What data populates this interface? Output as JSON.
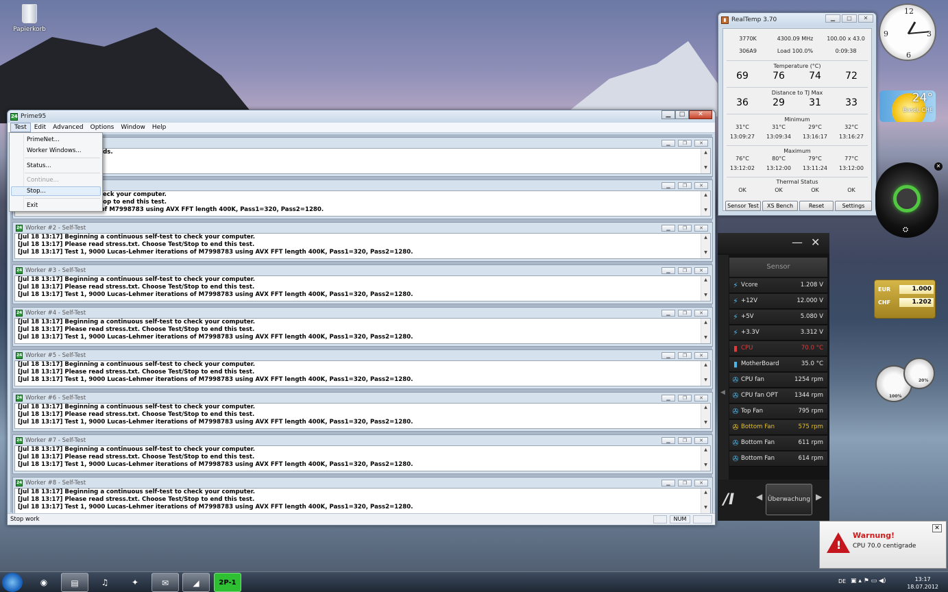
{
  "desktop": {
    "recycle_bin_label": "Papierkorb"
  },
  "prime95": {
    "title": "Prime95",
    "menu": [
      "Test",
      "Edit",
      "Advanced",
      "Options",
      "Window",
      "Help"
    ],
    "test_menu": {
      "items": [
        "PrimeNet...",
        "Worker Windows...",
        "Status...",
        "Continue...",
        "Stop...",
        "Exit"
      ],
      "highlighted": "Stop...",
      "disabled": [
        "Continue..."
      ]
    },
    "main_log": [
      "Stopping all worker threads.",
      "Execution halted.",
      "Starting workers."
    ],
    "worker1_log": [
      "continuous self-test to check your computer.",
      "stress.txt.  Choose Test/Stop to end this test.",
      "Lucas-Lehmer iterations of M7998783 using AVX FFT length 400K, Pass1=320, Pass2=1280."
    ],
    "workers": [
      {
        "title": "Worker #2 - Self-Test",
        "lines": [
          "[Jul 18 13:17] Beginning a continuous self-test to check your computer.",
          "[Jul 18 13:17] Please read stress.txt.  Choose Test/Stop to end this test.",
          "[Jul 18 13:17] Test 1, 9000 Lucas-Lehmer iterations of M7998783 using AVX FFT length 400K, Pass1=320, Pass2=1280."
        ]
      },
      {
        "title": "Worker #3 - Self-Test",
        "lines": [
          "[Jul 18 13:17] Beginning a continuous self-test to check your computer.",
          "[Jul 18 13:17] Please read stress.txt.  Choose Test/Stop to end this test.",
          "[Jul 18 13:17] Test 1, 9000 Lucas-Lehmer iterations of M7998783 using AVX FFT length 400K, Pass1=320, Pass2=1280."
        ]
      },
      {
        "title": "Worker #4 - Self-Test",
        "lines": [
          "[Jul 18 13:17] Beginning a continuous self-test to check your computer.",
          "[Jul 18 13:17] Please read stress.txt.  Choose Test/Stop to end this test.",
          "[Jul 18 13:17] Test 1, 9000 Lucas-Lehmer iterations of M7998783 using AVX FFT length 400K, Pass1=320, Pass2=1280."
        ]
      },
      {
        "title": "Worker #5 - Self-Test",
        "lines": [
          "[Jul 18 13:17] Beginning a continuous self-test to check your computer.",
          "[Jul 18 13:17] Please read stress.txt.  Choose Test/Stop to end this test.",
          "[Jul 18 13:17] Test 1, 9000 Lucas-Lehmer iterations of M7998783 using AVX FFT length 400K, Pass1=320, Pass2=1280."
        ]
      },
      {
        "title": "Worker #6 - Self-Test",
        "lines": [
          "[Jul 18 13:17] Beginning a continuous self-test to check your computer.",
          "[Jul 18 13:17] Please read stress.txt.  Choose Test/Stop to end this test.",
          "[Jul 18 13:17] Test 1, 9000 Lucas-Lehmer iterations of M7998783 using AVX FFT length 400K, Pass1=320, Pass2=1280."
        ]
      },
      {
        "title": "Worker #7 - Self-Test",
        "lines": [
          "[Jul 18 13:17] Beginning a continuous self-test to check your computer.",
          "[Jul 18 13:17] Please read stress.txt.  Choose Test/Stop to end this test.",
          "[Jul 18 13:17] Test 1, 9000 Lucas-Lehmer iterations of M7998783 using AVX FFT length 400K, Pass1=320, Pass2=1280."
        ]
      },
      {
        "title": "Worker #8 - Self-Test",
        "lines": [
          "[Jul 18 13:17] Beginning a continuous self-test to check your computer.",
          "[Jul 18 13:17] Please read stress.txt.  Choose Test/Stop to end this test.",
          "[Jul 18 13:17] Test 1, 9000 Lucas-Lehmer iterations of M7998783 using AVX FFT length 400K, Pass1=320, Pass2=1280."
        ]
      }
    ],
    "status_text": "Stop work",
    "status_num": "NUM"
  },
  "realtemp": {
    "title": "RealTemp 3.70",
    "cpu": "3770K",
    "mhz": "4300.09 MHz",
    "multiplier": "100.00 x 43.0",
    "cpuid": "306A9",
    "load": "Load 100.0%",
    "elapsed": "0:09:38",
    "temperature_label": "Temperature (°C)",
    "temperatures": [
      "69",
      "76",
      "74",
      "72"
    ],
    "distance_label": "Distance to TJ Max",
    "distances": [
      "36",
      "29",
      "31",
      "33"
    ],
    "minimum_label": "Minimum",
    "min_temps": [
      "31°C",
      "31°C",
      "29°C",
      "32°C"
    ],
    "min_times": [
      "13:09:27",
      "13:09:34",
      "13:16:17",
      "13:16:27"
    ],
    "maximum_label": "Maximum",
    "max_temps": [
      "76°C",
      "80°C",
      "79°C",
      "77°C"
    ],
    "max_times": [
      "13:12:02",
      "13:12:00",
      "13:11:24",
      "13:12:00"
    ],
    "thermal_label": "Thermal Status",
    "thermal": [
      "OK",
      "OK",
      "OK",
      "OK"
    ],
    "buttons": [
      "Sensor Test",
      "XS Bench",
      "Reset",
      "Settings"
    ]
  },
  "weather": {
    "temp": "24°",
    "location": "Basel, CHE"
  },
  "sensor_panel": {
    "header": "Sensor",
    "rows": [
      {
        "name": "Vcore",
        "value": "1.208  V",
        "icon": "bolt",
        "color": "#e6e6e6"
      },
      {
        "name": "+12V",
        "value": "12.000  V",
        "icon": "bolt",
        "color": "#e6e6e6"
      },
      {
        "name": "+5V",
        "value": "5.080  V",
        "icon": "bolt",
        "color": "#e6e6e6"
      },
      {
        "name": "+3.3V",
        "value": "3.312  V",
        "icon": "bolt",
        "color": "#e6e6e6"
      },
      {
        "name": "CPU",
        "value": "70.0 °C",
        "icon": "thermo",
        "color": "#e13a3a"
      },
      {
        "name": "MotherBoard",
        "value": "35.0 °C",
        "icon": "thermo",
        "color": "#e6e6e6"
      },
      {
        "name": "CPU fan",
        "value": "1254  rpm",
        "icon": "fan",
        "color": "#e6e6e6"
      },
      {
        "name": "CPU fan OPT",
        "value": "1344  rpm",
        "icon": "fan",
        "color": "#e6e6e6"
      },
      {
        "name": "Top Fan",
        "value": "795  rpm",
        "icon": "fan",
        "color": "#e6e6e6"
      },
      {
        "name": "Bottom Fan",
        "value": "575  rpm",
        "icon": "fan",
        "color": "#e3c030"
      },
      {
        "name": "Bottom Fan",
        "value": "611  rpm",
        "icon": "fan",
        "color": "#e6e6e6"
      },
      {
        "name": "Bottom Fan",
        "value": "614  rpm",
        "icon": "fan",
        "color": "#e6e6e6"
      }
    ],
    "mode_button": "Überwachung"
  },
  "currency": {
    "eur_label": "EUR",
    "eur_value": "1.000",
    "chf_label": "CHF",
    "chf_value": "1.202"
  },
  "meters": {
    "left": "100%",
    "right": "20%"
  },
  "warning": {
    "title": "Warnung!",
    "message": "CPU 70.0 centigrade"
  },
  "taskbar": {
    "language": "DE",
    "time": "13:17",
    "date": "18.07.2012",
    "prime_label": "2P-1"
  }
}
